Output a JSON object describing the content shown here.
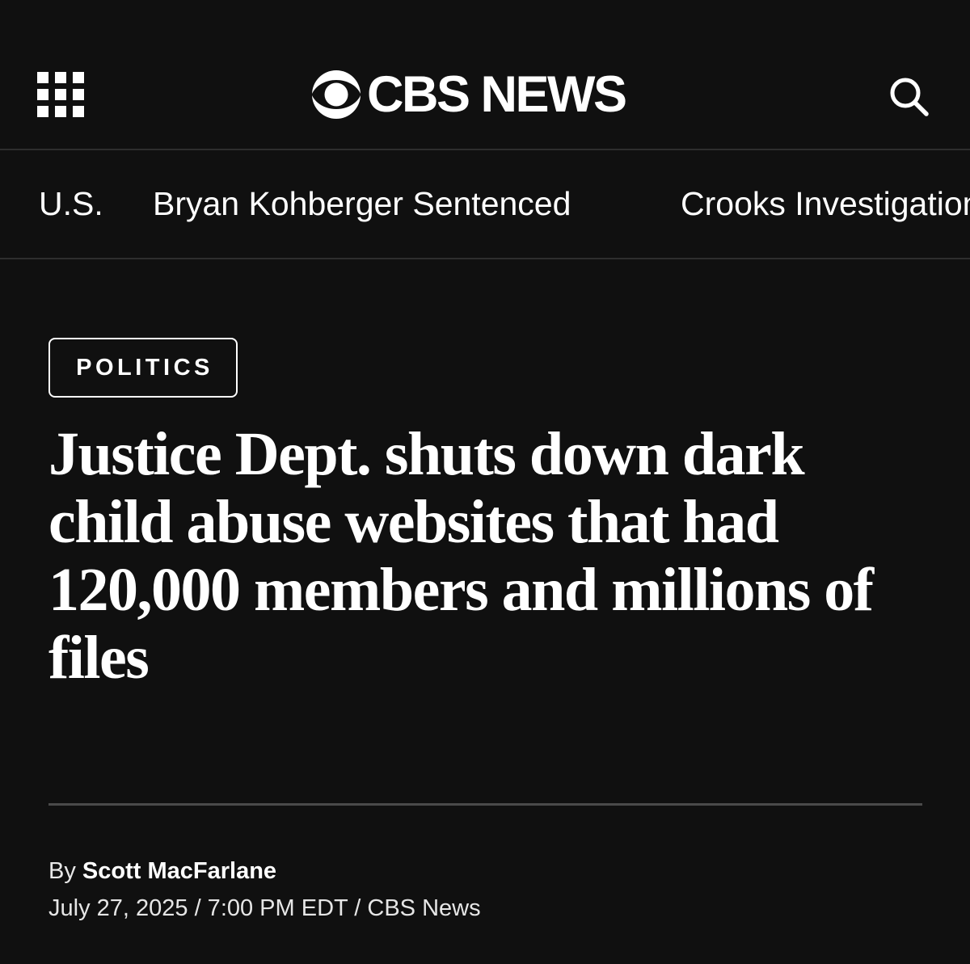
{
  "header": {
    "menu_icon": "grid-menu-icon",
    "logo_text": "CBS NEWS",
    "logo_icon": "cbs-eye-icon",
    "search_icon": "search-icon"
  },
  "subnav": {
    "items": [
      {
        "label": "U.S."
      },
      {
        "label": "Bryan Kohberger Sentenced"
      },
      {
        "label": "Crooks Investigation"
      }
    ]
  },
  "article": {
    "category": "POLITICS",
    "headline": "Justice Dept. shuts down dark child abuse websites that had 120,000 members and millions of files",
    "byline": {
      "prefix": "By",
      "author": "Scott MacFarlane"
    },
    "dateline": "July 27, 2025 / 7:00 PM EDT / CBS News"
  },
  "colors": {
    "background": "#101010",
    "text": "#ffffff",
    "divider": "#4a4a4a"
  }
}
